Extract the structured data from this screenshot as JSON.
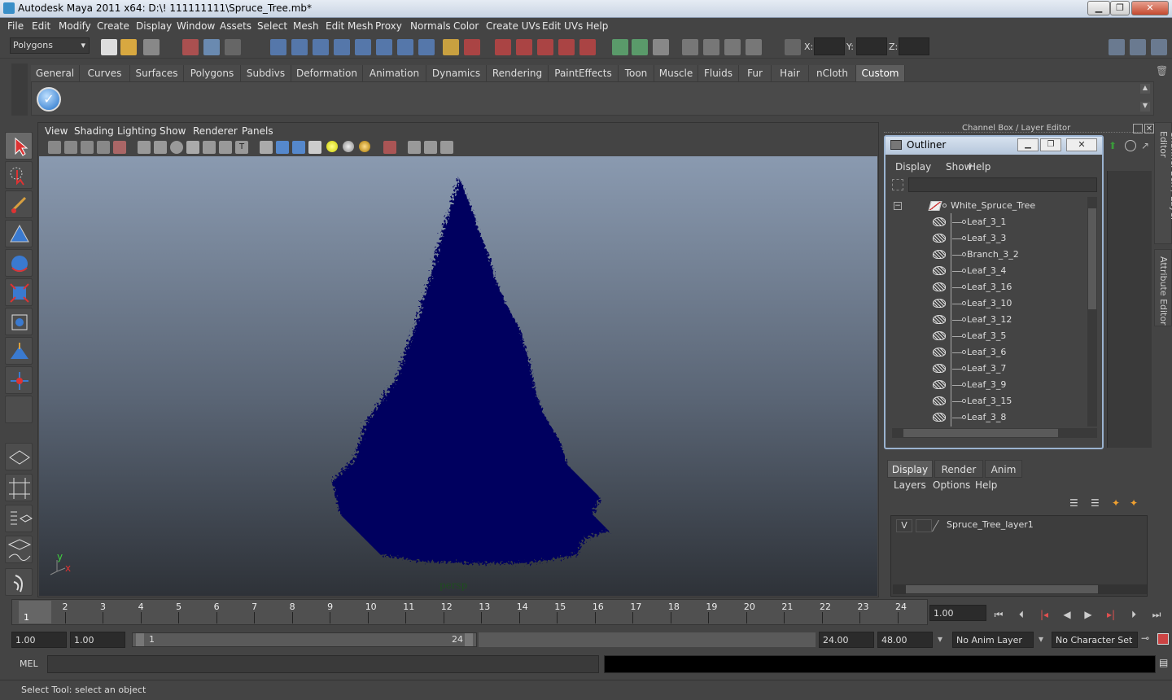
{
  "window": {
    "title": "Autodesk Maya 2011 x64: D:\\! 111111111\\Spruce_Tree.mb*",
    "min": "▁",
    "max": "❐",
    "close": "✕"
  },
  "menubar": [
    "File",
    "Edit",
    "Modify",
    "Create",
    "Display",
    "Window",
    "Assets",
    "Select",
    "Mesh",
    "Edit Mesh",
    "Proxy",
    "Normals",
    "Color",
    "Create UVs",
    "Edit UVs",
    "Help"
  ],
  "statusline": {
    "mode": "Polygons",
    "x_label": "X:",
    "y_label": "Y:",
    "z_label": "Z:"
  },
  "shelf_tabs": [
    "General",
    "Curves",
    "Surfaces",
    "Polygons",
    "Subdivs",
    "Deformation",
    "Animation",
    "Dynamics",
    "Rendering",
    "PaintEffects",
    "Toon",
    "Muscle",
    "Fluids",
    "Fur",
    "Hair",
    "nCloth",
    "Custom"
  ],
  "shelf_active": "Custom",
  "viewport": {
    "menus": [
      "View",
      "Shading",
      "Lighting",
      "Show",
      "Renderer",
      "Panels"
    ],
    "camera": "persp",
    "axis_y": "y",
    "axis_x": "x",
    "tree_color": "#00005e"
  },
  "channel_box": {
    "title": "Channel Box / Layer Editor",
    "side_tab_1": "Channel Box / Layer Editor",
    "side_tab_2": "Attribute Editor"
  },
  "outliner": {
    "title": "Outliner",
    "menus": [
      "Display",
      "Show",
      "Help"
    ],
    "root": "White_Spruce_Tree",
    "items": [
      "Leaf_3_1",
      "Leaf_3_3",
      "Branch_3_2",
      "Leaf_3_4",
      "Leaf_3_16",
      "Leaf_3_10",
      "Leaf_3_12",
      "Leaf_3_5",
      "Leaf_3_6",
      "Leaf_3_7",
      "Leaf_3_9",
      "Leaf_3_15",
      "Leaf_3_8"
    ]
  },
  "layer_editor": {
    "tabs": [
      "Display",
      "Render",
      "Anim"
    ],
    "menus": [
      "Layers",
      "Options",
      "Help"
    ],
    "layer_visibility": "V",
    "layer_name": "Spruce_Tree_layer1"
  },
  "timeline": {
    "ticks": [
      "1",
      "2",
      "3",
      "4",
      "5",
      "6",
      "7",
      "8",
      "9",
      "10",
      "11",
      "12",
      "13",
      "14",
      "15",
      "16",
      "17",
      "18",
      "19",
      "20",
      "21",
      "22",
      "23",
      "24"
    ],
    "current_frame": "1",
    "current_time": "1.00"
  },
  "range": {
    "start": "1.00",
    "start2": "1.00",
    "range_start": "1",
    "range_end": "24",
    "end": "24.00",
    "end2": "48.00",
    "anim_layer": "No Anim Layer",
    "char_set": "No Character Set"
  },
  "cmdline": {
    "label": "MEL"
  },
  "helpline": {
    "text": "Select Tool: select an object"
  }
}
